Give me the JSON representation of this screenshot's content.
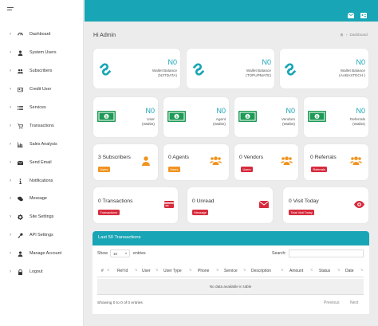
{
  "sidebar": {
    "items": [
      {
        "label": "Dashboard",
        "icon": "dashboard-icon"
      },
      {
        "label": "System Users",
        "icon": "user-icon"
      },
      {
        "label": "Subscribers",
        "icon": "users-icon"
      },
      {
        "label": "Credit User",
        "icon": "user-card-icon"
      },
      {
        "label": "Services",
        "icon": "list-icon"
      },
      {
        "label": "Transactions",
        "icon": "cart-icon"
      },
      {
        "label": "Sales Analysis",
        "icon": "chart-icon"
      },
      {
        "label": "Send Email",
        "icon": "envelope-icon"
      },
      {
        "label": "Notifications",
        "icon": "info-icon"
      },
      {
        "label": "Message",
        "icon": "chat-icon"
      },
      {
        "label": "Site Settings",
        "icon": "gear-icon"
      },
      {
        "label": "API Settings",
        "icon": "key-icon"
      },
      {
        "label": "Manage Account",
        "icon": "user-icon"
      },
      {
        "label": "Logout",
        "icon": "lock-icon"
      }
    ]
  },
  "header": {
    "title": "Hi Admin",
    "breadcrumb": "Dashboard"
  },
  "wallets": [
    {
      "value": "N0",
      "label": "Wallet Balance",
      "sub": "(N3TDATA)"
    },
    {
      "value": "N0",
      "label": "Wallet Balance",
      "sub": "(TOPUPMATE)"
    },
    {
      "value": "N0",
      "label": "Wallet Balance",
      "sub": "(AABAXTECH )"
    }
  ],
  "wallet_types": [
    {
      "value": "N0",
      "label": "User",
      "sub": "(Wallet)"
    },
    {
      "value": "N0",
      "label": "Agent",
      "sub": "(Wallet)"
    },
    {
      "value": "N0",
      "label": "Vendors",
      "sub": "(Wallet)"
    },
    {
      "value": "N0",
      "label": "Referrals",
      "sub": "(Wallet)"
    }
  ],
  "counts": [
    {
      "value": "3 Subscribers",
      "badge": "Users",
      "icon": "user-icon"
    },
    {
      "value": "0 Agents",
      "badge": "Users",
      "icon": "users-icon"
    },
    {
      "value": "0 Vendors",
      "badge": "Users",
      "icon": "users-icon"
    },
    {
      "value": "0 Referrals",
      "badge": "Referrals",
      "icon": "users-icon"
    }
  ],
  "activity": [
    {
      "value": "0 Transactions",
      "badge": "Transactions",
      "icon": "credit-card-icon"
    },
    {
      "value": "0 Unread",
      "badge": "Message",
      "icon": "envelope-icon"
    },
    {
      "value": "0 Visit Today",
      "badge": "Total Visit Today",
      "icon": "eye-icon"
    }
  ],
  "table": {
    "title": "Last 50 Transactions",
    "show_label": "Show",
    "length_value": "10",
    "entries_label": "entries",
    "search_label": "Search:",
    "columns": [
      "#",
      "Ref Id",
      "User",
      "User Type",
      "Phone",
      "Service",
      "Description",
      "Amount",
      "Status",
      "Date"
    ],
    "empty_text": "No data available in table",
    "info": "Showing 0 to 0 of 0 entries",
    "previous": "Previous",
    "next": "Next"
  },
  "colors": {
    "accent": "#18a5b5",
    "badge_orange": "#f0931e",
    "badge_red": "#d72a3c",
    "money_green": "#1e9a56"
  }
}
